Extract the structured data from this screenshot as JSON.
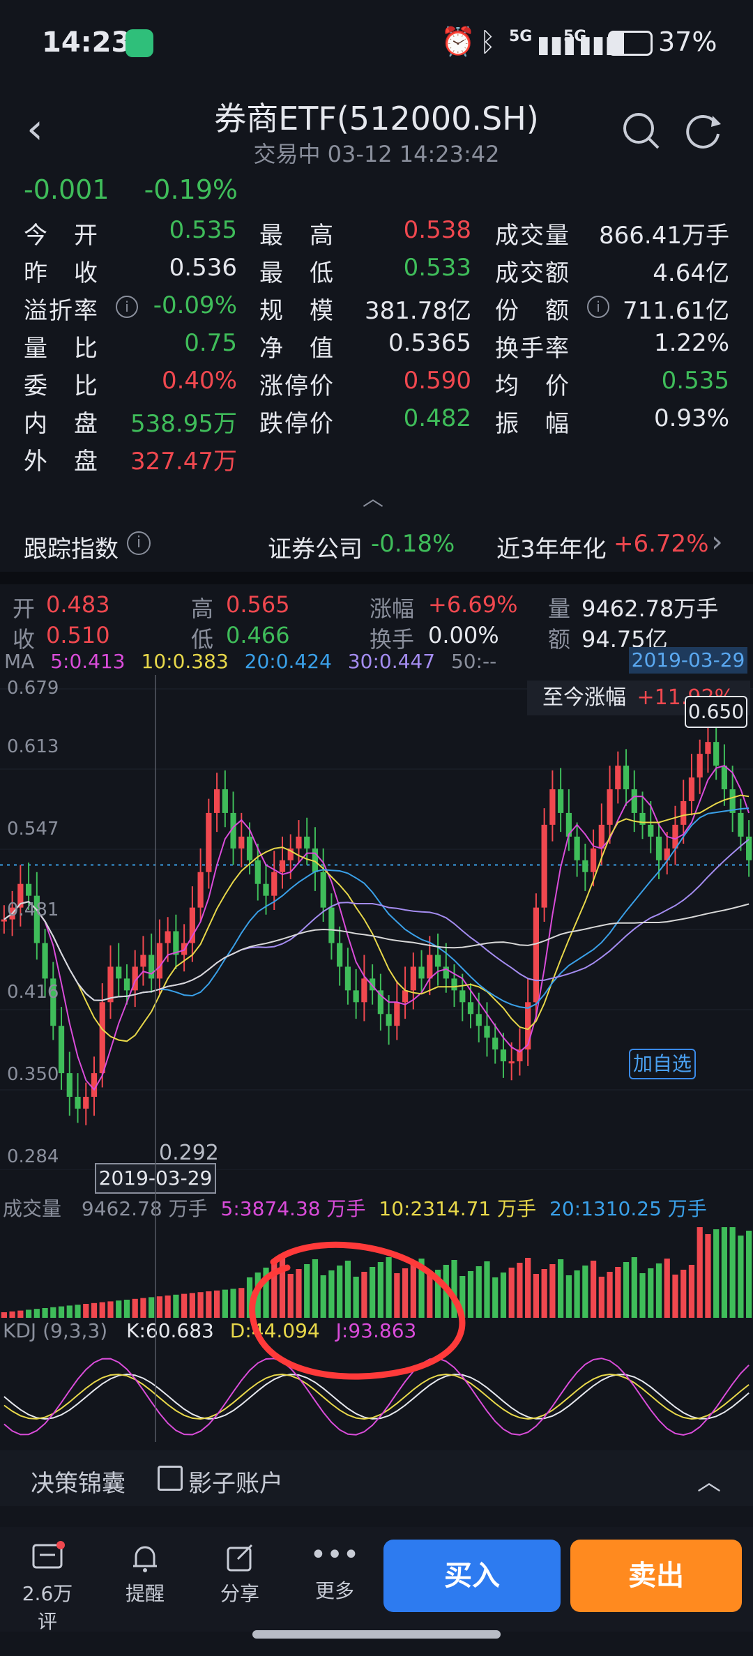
{
  "status_bar": {
    "time": "14:23",
    "battery": "37%",
    "signal1": "5G",
    "signal2": "5G"
  },
  "header": {
    "title": "券商ETF(512000.SH)",
    "subtitle": "交易中 03-12 14:23:42"
  },
  "price_change": {
    "abs": "-0.001",
    "pct": "-0.19%"
  },
  "quote": [
    [
      {
        "label": "今　开",
        "value": "0.535",
        "color": "green"
      },
      {
        "label": "最　高",
        "value": "0.538",
        "color": "red"
      },
      {
        "label": "成交量",
        "value": "866.41万手",
        "color": "white"
      }
    ],
    [
      {
        "label": "昨　收",
        "value": "0.536",
        "color": "white"
      },
      {
        "label": "最　低",
        "value": "0.533",
        "color": "green"
      },
      {
        "label": "成交额",
        "value": "4.64亿",
        "color": "white"
      }
    ],
    [
      {
        "label": "溢折率",
        "value": "-0.09%",
        "color": "green",
        "info": true
      },
      {
        "label": "规　模",
        "value": "381.78亿",
        "color": "white"
      },
      {
        "label": "份　额",
        "value": "711.61亿",
        "color": "white",
        "info": true
      }
    ],
    [
      {
        "label": "量　比",
        "value": "0.75",
        "color": "green"
      },
      {
        "label": "净　值",
        "value": "0.5365",
        "color": "white"
      },
      {
        "label": "换手率",
        "value": "1.22%",
        "color": "white"
      }
    ],
    [
      {
        "label": "委　比",
        "value": "0.40%",
        "color": "red"
      },
      {
        "label": "涨停价",
        "value": "0.590",
        "color": "red"
      },
      {
        "label": "均　价",
        "value": "0.535",
        "color": "green"
      }
    ],
    [
      {
        "label": "内　盘",
        "value": "538.95万",
        "color": "green"
      },
      {
        "label": "跌停价",
        "value": "0.482",
        "color": "green"
      },
      {
        "label": "振　幅",
        "value": "0.93%",
        "color": "white"
      }
    ],
    [
      {
        "label": "外　盘",
        "value": "327.47万",
        "color": "red"
      }
    ]
  ],
  "tracking": {
    "label": "跟踪指数",
    "index": "证券公司",
    "index_change": "-0.18%",
    "annual_label": "近3年年化",
    "annual_value": "+6.72%"
  },
  "kline_info": {
    "open_label": "开",
    "open": "0.483",
    "high_label": "高",
    "high": "0.565",
    "change_label": "涨幅",
    "change": "+6.69%",
    "vol_label": "量",
    "vol": "9462.78万手",
    "close_label": "收",
    "close": "0.510",
    "low_label": "低",
    "low": "0.466",
    "turnover_label": "换手",
    "turnover": "0.00%",
    "amt_label": "额",
    "amt": "94.75亿"
  },
  "ma": {
    "label": "MA",
    "ma5": "5:0.413",
    "ma10": "10:0.383",
    "ma20": "20:0.424",
    "ma30": "30:0.447",
    "ma50": "50:--"
  },
  "chart_labels": {
    "top_date": "2019-03-29",
    "since_label": "至今涨幅",
    "since_value": "+11.92%",
    "price_tag": "0.650",
    "low_tag": "0.292",
    "bottom_date": "2019-03-29",
    "add_watch": "加自选"
  },
  "y_axis": [
    "0.679",
    "0.613",
    "0.547",
    "0.481",
    "0.416",
    "0.350",
    "0.284"
  ],
  "volume": {
    "label": "成交量",
    "value": "9462.78 万手",
    "v5": "5:3874.38 万手",
    "v10": "10:2314.71 万手",
    "v20": "20:1310.25 万手"
  },
  "kdj": {
    "label": "KDJ",
    "params": "(9,3,3)",
    "k": "K:60.683",
    "d": "D:44.094",
    "j": "J:93.863"
  },
  "tools": {
    "decision": "决策锦囊",
    "shadow": "影子账户"
  },
  "nav": {
    "comments": "2.6万评",
    "alert": "提醒",
    "share": "分享",
    "more": "更多",
    "buy": "买入",
    "sell": "卖出"
  },
  "colors": {
    "up": "#f0484f",
    "down": "#3fbd5a",
    "ma5": "#d94cd9",
    "ma10": "#e8d84a",
    "ma20": "#3aa0e8",
    "ma30": "#a48cf0",
    "buy": "#2d7bf0",
    "sell": "#ff8a1f"
  }
}
